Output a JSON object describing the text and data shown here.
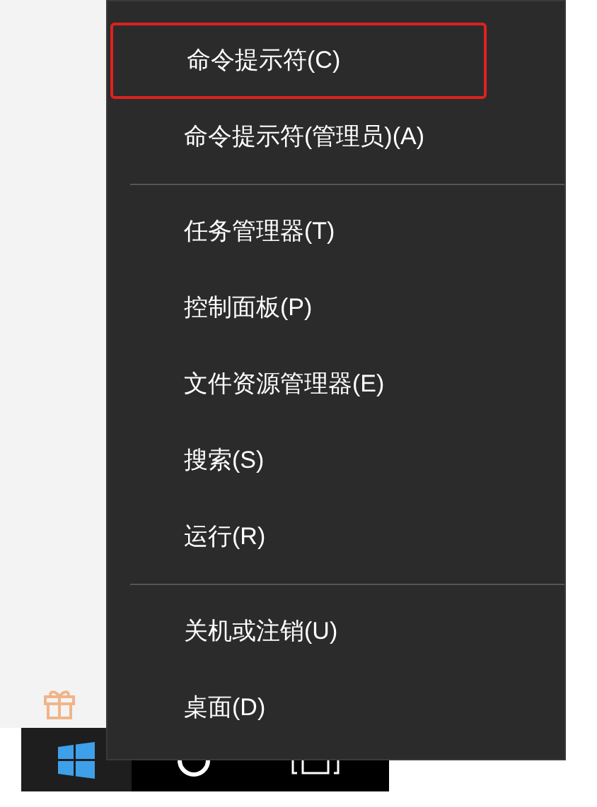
{
  "menu": {
    "groups": [
      {
        "items": [
          {
            "label": "命令提示符(C)",
            "selected": true
          },
          {
            "label": "命令提示符(管理员)(A)",
            "selected": false
          }
        ]
      },
      {
        "items": [
          {
            "label": "任务管理器(T)",
            "selected": false
          },
          {
            "label": "控制面板(P)",
            "selected": false
          },
          {
            "label": "文件资源管理器(E)",
            "selected": false
          },
          {
            "label": "搜索(S)",
            "selected": false
          },
          {
            "label": "运行(R)",
            "selected": false
          }
        ]
      },
      {
        "items": [
          {
            "label": "关机或注销(U)",
            "selected": false
          },
          {
            "label": "桌面(D)",
            "selected": false
          }
        ]
      }
    ]
  }
}
